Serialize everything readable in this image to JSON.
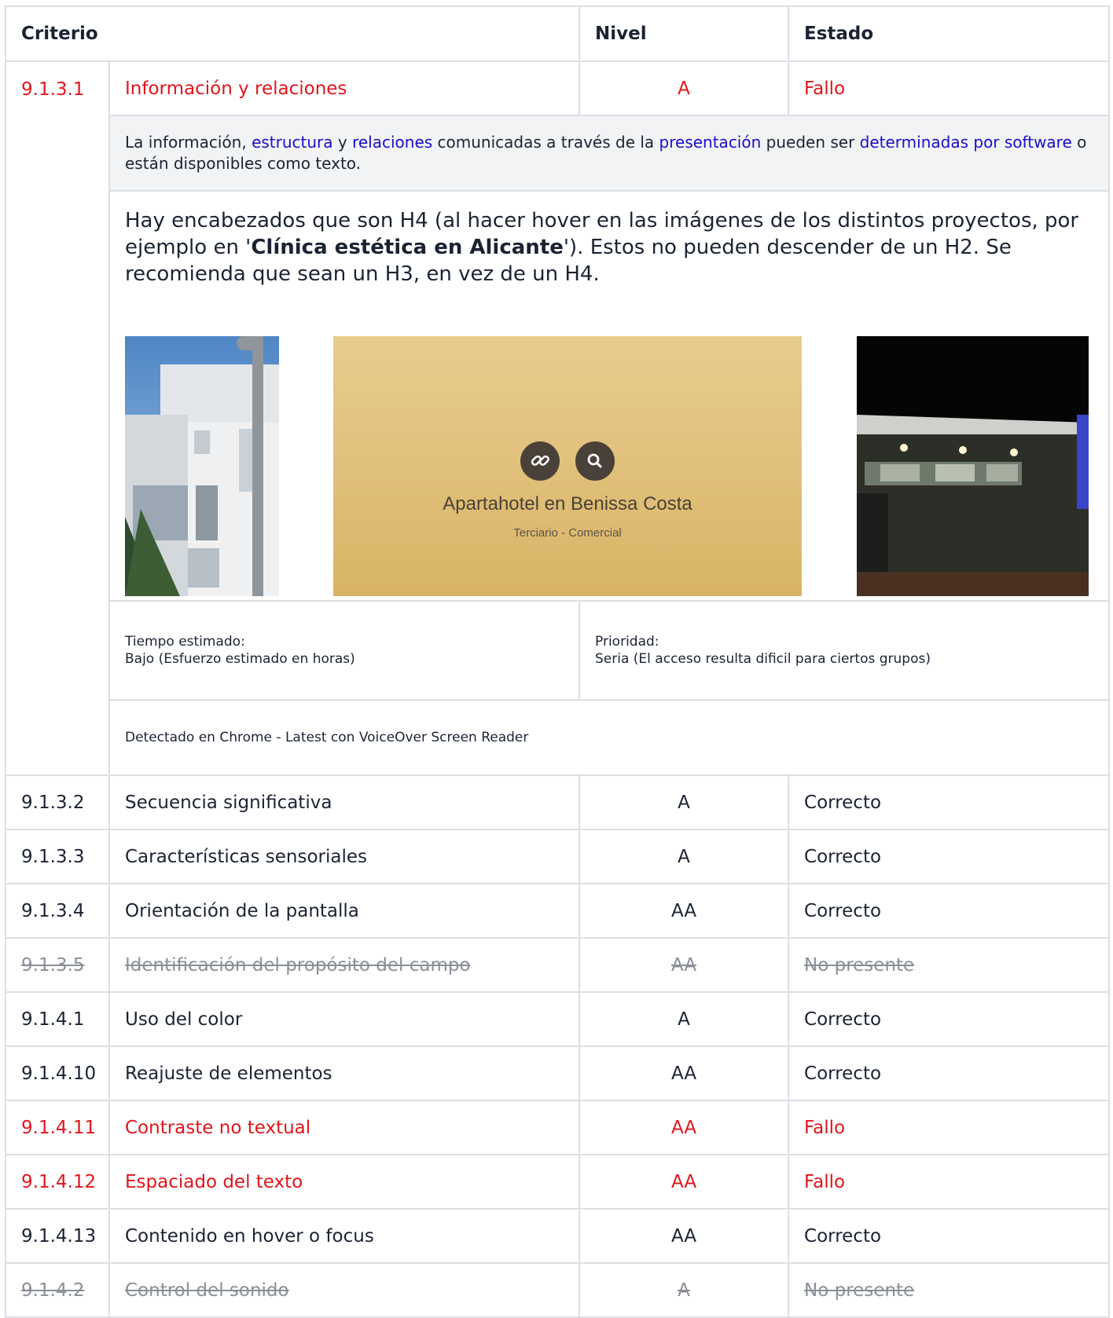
{
  "headers": {
    "criterio": "Criterio",
    "nivel": "Nivel",
    "estado": "Estado"
  },
  "colors": {
    "fail": "#e0161b",
    "link": "#1a0dcc",
    "muted": "#8a8f98",
    "desc_bg": "#f2f3f5"
  },
  "expanded": {
    "id": "9.1.3.1",
    "name": "Información y relaciones",
    "level": "A",
    "status": "Fallo",
    "desc": {
      "t1": "La información, ",
      "l1": "estructura",
      "t2": " y ",
      "l2": "relaciones",
      "t3": " comunicadas a través de la ",
      "l3": "presentación",
      "t4": " pueden ser ",
      "l4": "determinadas por software",
      "t5": " o están disponibles como texto."
    },
    "detail": {
      "p1": "Hay encabezados que son H4 (al hacer hover en las imágenes de los distintos proyectos, por ejemplo en '",
      "bold": "Clínica estética en Alicante",
      "p2": "'). Estos no pueden descender de un H2. Se recomienda que sean un H3, en vez de un H4."
    },
    "screenshot": {
      "title": "Apartahotel en Benissa Costa",
      "subtitle": "Terciario - Comercial",
      "link_icon": "link-icon",
      "search_icon": "search-icon"
    },
    "time_label": "Tiempo estimado:",
    "time_value": "Bajo (Esfuerzo estimado en horas)",
    "priority_label": "Prioridad:",
    "priority_value": "Seria (El acceso resulta dificil para ciertos grupos)",
    "detected": "Detectado en Chrome - Latest con VoiceOver Screen Reader"
  },
  "rows": [
    {
      "id": "9.1.3.2",
      "name": "Secuencia significativa",
      "level": "A",
      "status": "Correcto"
    },
    {
      "id": "9.1.3.3",
      "name": "Características sensoriales",
      "level": "A",
      "status": "Correcto"
    },
    {
      "id": "9.1.3.4",
      "name": "Orientación de la pantalla",
      "level": "AA",
      "status": "Correcto"
    },
    {
      "id": "9.1.3.5",
      "name": "Identificación del propósito del campo",
      "level": "AA",
      "status": "No presente"
    },
    {
      "id": "9.1.4.1",
      "name": "Uso del color",
      "level": "A",
      "status": "Correcto"
    },
    {
      "id": "9.1.4.10",
      "name": "Reajuste de elementos",
      "level": "AA",
      "status": "Correcto"
    },
    {
      "id": "9.1.4.11",
      "name": "Contraste no textual",
      "level": "AA",
      "status": "Fallo"
    },
    {
      "id": "9.1.4.12",
      "name": "Espaciado del texto",
      "level": "AA",
      "status": "Fallo"
    },
    {
      "id": "9.1.4.13",
      "name": "Contenido en hover o focus",
      "level": "AA",
      "status": "Correcto"
    },
    {
      "id": "9.1.4.2",
      "name": "Control del sonido",
      "level": "A",
      "status": "No presente"
    }
  ]
}
